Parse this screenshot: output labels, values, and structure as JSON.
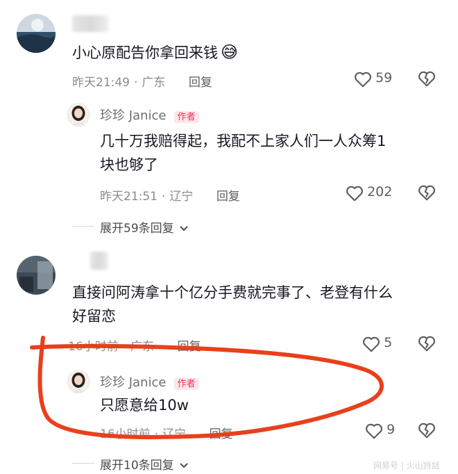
{
  "comment1": {
    "text": "小心原配告你拿回来钱",
    "emoji": "😅",
    "time": "昨天21:49",
    "location": "广东",
    "reply_label": "回复",
    "like_count": "59"
  },
  "reply1": {
    "author": "珍珍 Janice",
    "badge": "作者",
    "text_line1": "几十万我赔得起，我配不上家人们一人众筹1",
    "text_line2": "块也够了",
    "time": "昨天21:51",
    "location": "辽宁",
    "reply_label": "回复",
    "like_count": "202"
  },
  "expand1": {
    "label": "展开59条回复"
  },
  "comment2": {
    "text_line1": "直接问阿涛拿十个亿分手费就完事了、老登有什么",
    "text_line2": "好留恋",
    "time": "16小时前",
    "location": "广东",
    "reply_label": "回复",
    "like_count": "5"
  },
  "reply2": {
    "author": "珍珍 Janice",
    "badge": "作者",
    "text": "只愿意给10w",
    "time": "16小时前",
    "location": "辽宁",
    "reply_label": "回复",
    "like_count": "9"
  },
  "expand2": {
    "label": "展开10条回复"
  },
  "watermark": {
    "text": "网易号 | 火山詩話"
  },
  "colors": {
    "annotation": "#e8401c",
    "author_badge": "#fe2c55"
  }
}
